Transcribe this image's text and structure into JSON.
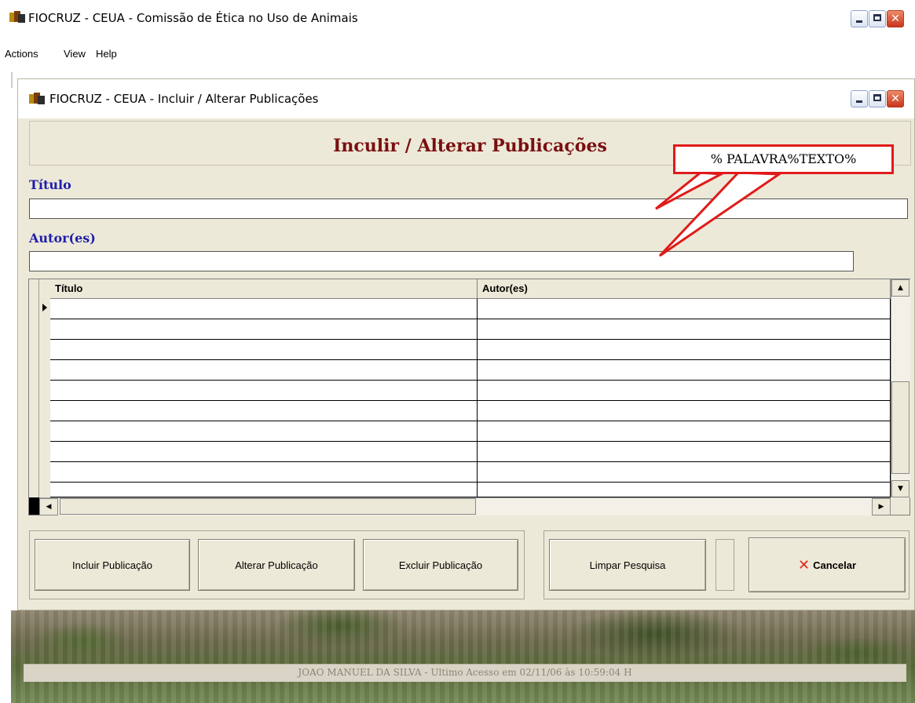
{
  "main_window": {
    "title": "FIOCRUZ - CEUA - Comissão de Ética no Uso de Animais",
    "menu": [
      "Actions",
      "View",
      "Help"
    ]
  },
  "child_window": {
    "title": "FIOCRUZ - CEUA - Incluir / Alterar Publicações",
    "heading": "Inculir / Alterar  Publicações"
  },
  "form": {
    "titulo_label": "Título",
    "titulo_value": "",
    "autores_label": "Autor(es)",
    "autores_value": ""
  },
  "callout": {
    "text": "% PALAVRA%TEXTO%",
    "color": "#e01a1a"
  },
  "grid": {
    "columns": [
      "Título",
      "Autor(es)"
    ],
    "rows": [
      [
        "",
        ""
      ],
      [
        "",
        ""
      ],
      [
        "",
        ""
      ],
      [
        "",
        ""
      ],
      [
        "",
        ""
      ],
      [
        "",
        ""
      ],
      [
        "",
        ""
      ],
      [
        "",
        ""
      ],
      [
        "",
        ""
      ],
      [
        "",
        ""
      ]
    ]
  },
  "buttons": {
    "incluir": "Incluir Publicação",
    "alterar": "Alterar Publicação",
    "excluir": "Excluir Publicação",
    "limpar": "Limpar Pesquisa",
    "cancelar": "Cancelar"
  },
  "status_bar": {
    "text": "JOAO MANUEL DA SILVA - Ultimo Acesso em 02/11/06 às 10:59:04 H"
  },
  "colors": {
    "heading": "#7a0f10",
    "field_label": "#1f1fa8",
    "window_face": "#ece9d8"
  }
}
